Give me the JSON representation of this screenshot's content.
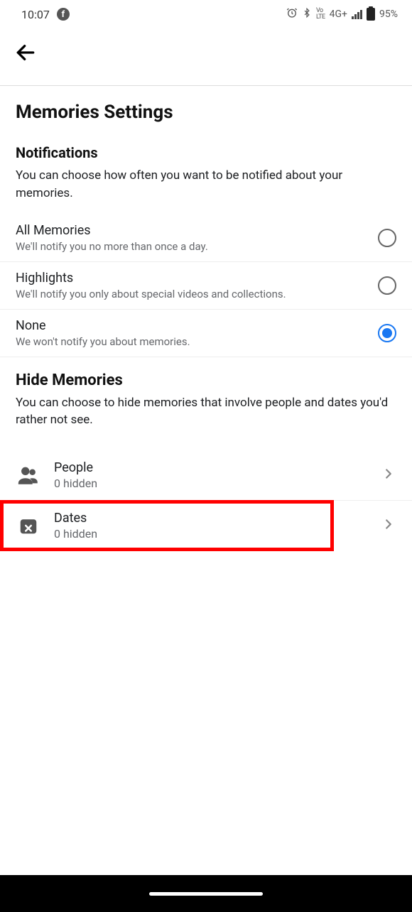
{
  "status": {
    "time": "10:07",
    "network": "4G+",
    "volte": "Vo LTE",
    "battery": "95%"
  },
  "pageTitle": "Memories Settings",
  "notifications": {
    "title": "Notifications",
    "desc": "You can choose how often you want to be notified about your memories.",
    "options": [
      {
        "title": "All Memories",
        "sub": "We'll notify you no more than once a day.",
        "selected": false
      },
      {
        "title": "Highlights",
        "sub": "We'll notify you only about special videos and collections.",
        "selected": false
      },
      {
        "title": "None",
        "sub": "We won't notify you about memories.",
        "selected": true
      }
    ]
  },
  "hide": {
    "title": "Hide Memories",
    "desc": "You can choose to hide memories that involve people and dates you'd rather not see.",
    "items": [
      {
        "title": "People",
        "sub": "0 hidden"
      },
      {
        "title": "Dates",
        "sub": "0 hidden"
      }
    ]
  }
}
